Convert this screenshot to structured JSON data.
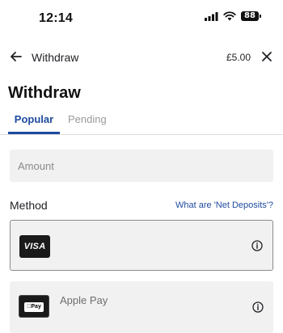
{
  "status_bar": {
    "time": "12:14",
    "battery": "88",
    "icons": [
      "cellular-signal-icon",
      "wifi-icon",
      "battery-icon"
    ]
  },
  "topnav": {
    "back_icon": "arrow-left-icon",
    "title": "Withdraw",
    "balance": "£5.00",
    "close_icon": "close-icon"
  },
  "page": {
    "title": "Withdraw"
  },
  "tabs": [
    {
      "label": "Popular",
      "active": true
    },
    {
      "label": "Pending",
      "active": false
    }
  ],
  "amount": {
    "value": "",
    "placeholder": "Amount"
  },
  "method": {
    "label": "Method",
    "help_link": "What are 'Net Deposits'?",
    "options": [
      {
        "name": "",
        "logo_text": "VISA",
        "selected": true,
        "info_icon": "info-icon"
      },
      {
        "name": "Apple Pay",
        "logo_text": "Pay",
        "selected": false,
        "info_icon": "info-icon"
      }
    ]
  },
  "colors": {
    "accent": "#1e4a9e",
    "field_background": "#f1f1f1",
    "text": "#1f2024",
    "muted": "#9a9a9a"
  }
}
